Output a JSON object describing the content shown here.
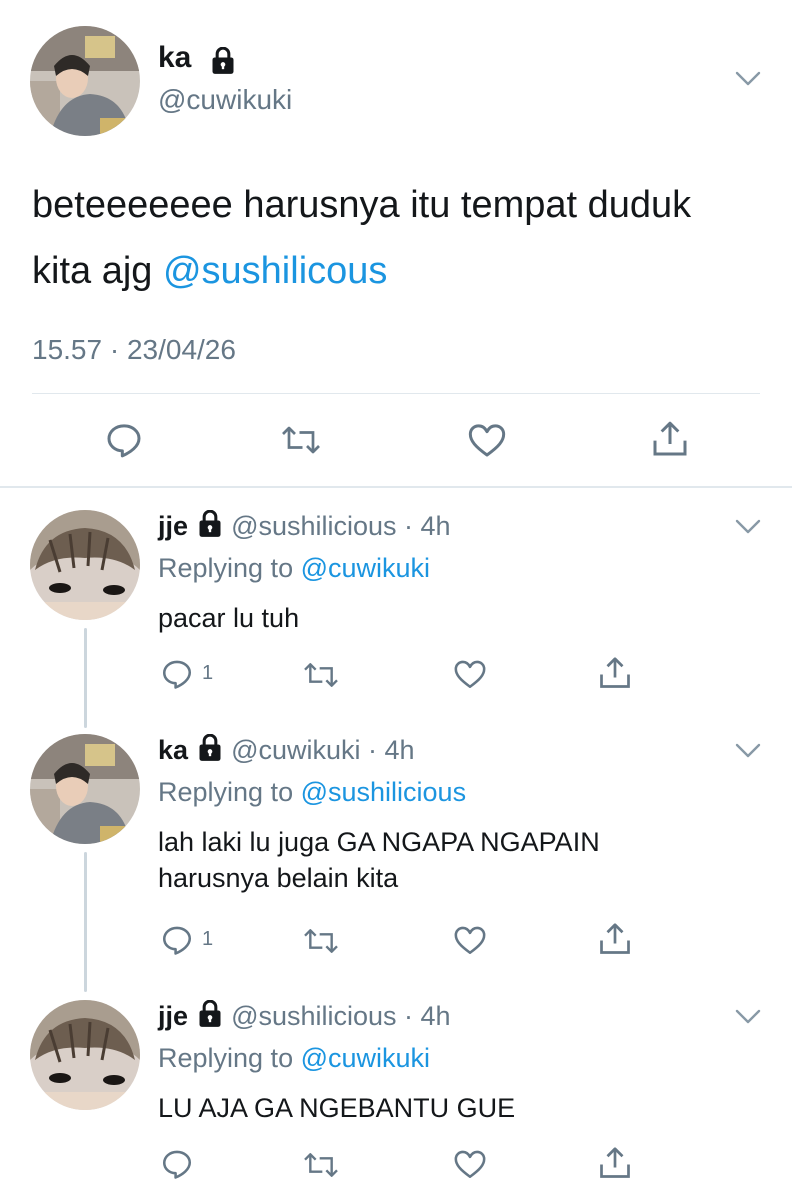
{
  "main_tweet": {
    "display_name": "ka",
    "handle": "@cuwikuki",
    "text_prefix": "beteeeeeee harusnya itu tempat duduk kita ajg",
    "mention": "@sushilicous",
    "timestamp": "15.57 · 23/04/26",
    "icons": [
      "reply-icon",
      "retweet-icon",
      "like-icon",
      "share-icon",
      "lock-icon",
      "chevron-down-icon"
    ]
  },
  "replies": [
    {
      "display_name": "jje",
      "handle": "@sushilicious",
      "time": "· 4h",
      "replying_label": "Replying to",
      "replying_to": "@cuwikuki",
      "text_line1": "pacar lu tuh",
      "text_line2": "",
      "reply_count": "1"
    },
    {
      "display_name": "ka",
      "handle": "@cuwikuki",
      "time": "· 4h",
      "replying_label": "Replying to",
      "replying_to": "@sushilicious",
      "text_line1": "lah laki lu juga GA NGAPA NGAPAIN",
      "text_line2": "harusnya belain kita",
      "reply_count": "1"
    },
    {
      "display_name": "jje",
      "handle": "@sushilicious",
      "time": "· 4h",
      "replying_label": "Replying to",
      "replying_to": "@cuwikuki",
      "text_line1": "LU AJA GA NGEBANTU GUE",
      "text_line2": "",
      "reply_count": ""
    }
  ],
  "colors": {
    "link": "#1b95e0",
    "muted": "#657786",
    "divider": "#e1e8ed",
    "thread_line": "#ccd6dd"
  }
}
